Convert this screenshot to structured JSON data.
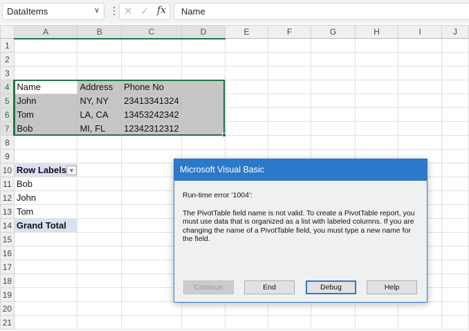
{
  "formula_bar": {
    "name_box": "DataItems",
    "formula": "Name",
    "fx_label": "fx",
    "cancel_icon": "✕",
    "enter_icon": "✓"
  },
  "columns": [
    "A",
    "B",
    "C",
    "D",
    "E",
    "F",
    "G",
    "H",
    "I",
    "J"
  ],
  "rows": [
    "1",
    "2",
    "3",
    "4",
    "5",
    "6",
    "7",
    "8",
    "9",
    "10",
    "11",
    "12",
    "13",
    "14",
    "15",
    "16",
    "17",
    "18",
    "19",
    "20",
    "21"
  ],
  "cells": {
    "4": [
      "Name",
      "Address",
      "Phone No",
      ""
    ],
    "5": [
      "John",
      "NY, NY",
      " 23413341324",
      ""
    ],
    "6": [
      "Tom",
      "LA, CA",
      " 13453242342",
      ""
    ],
    "7": [
      "Bob",
      "MI, FL",
      " 12342312312",
      ""
    ],
    "10": [
      "Row Labels"
    ],
    "11": [
      "Bob"
    ],
    "12": [
      "John"
    ],
    "13": [
      "Tom"
    ],
    "14": [
      "Grand Total"
    ]
  },
  "dialog": {
    "title": "Microsoft Visual Basic",
    "error": "Run-time error '1004':",
    "message": "The PivotTable field name is not valid. To create a PivotTable report, you must use data that is organized as a list with labeled columns. If you are changing the name of a PivotTable field, you must type a new name for the field.",
    "buttons": {
      "continue": "Continue",
      "end": "End",
      "debug": "Debug",
      "help": "Help"
    }
  },
  "colors": {
    "accent": "#217346",
    "dialog_title": "#2b79c8",
    "selection": "#c6c6c6",
    "pivot_header": "#d9e1f2"
  }
}
